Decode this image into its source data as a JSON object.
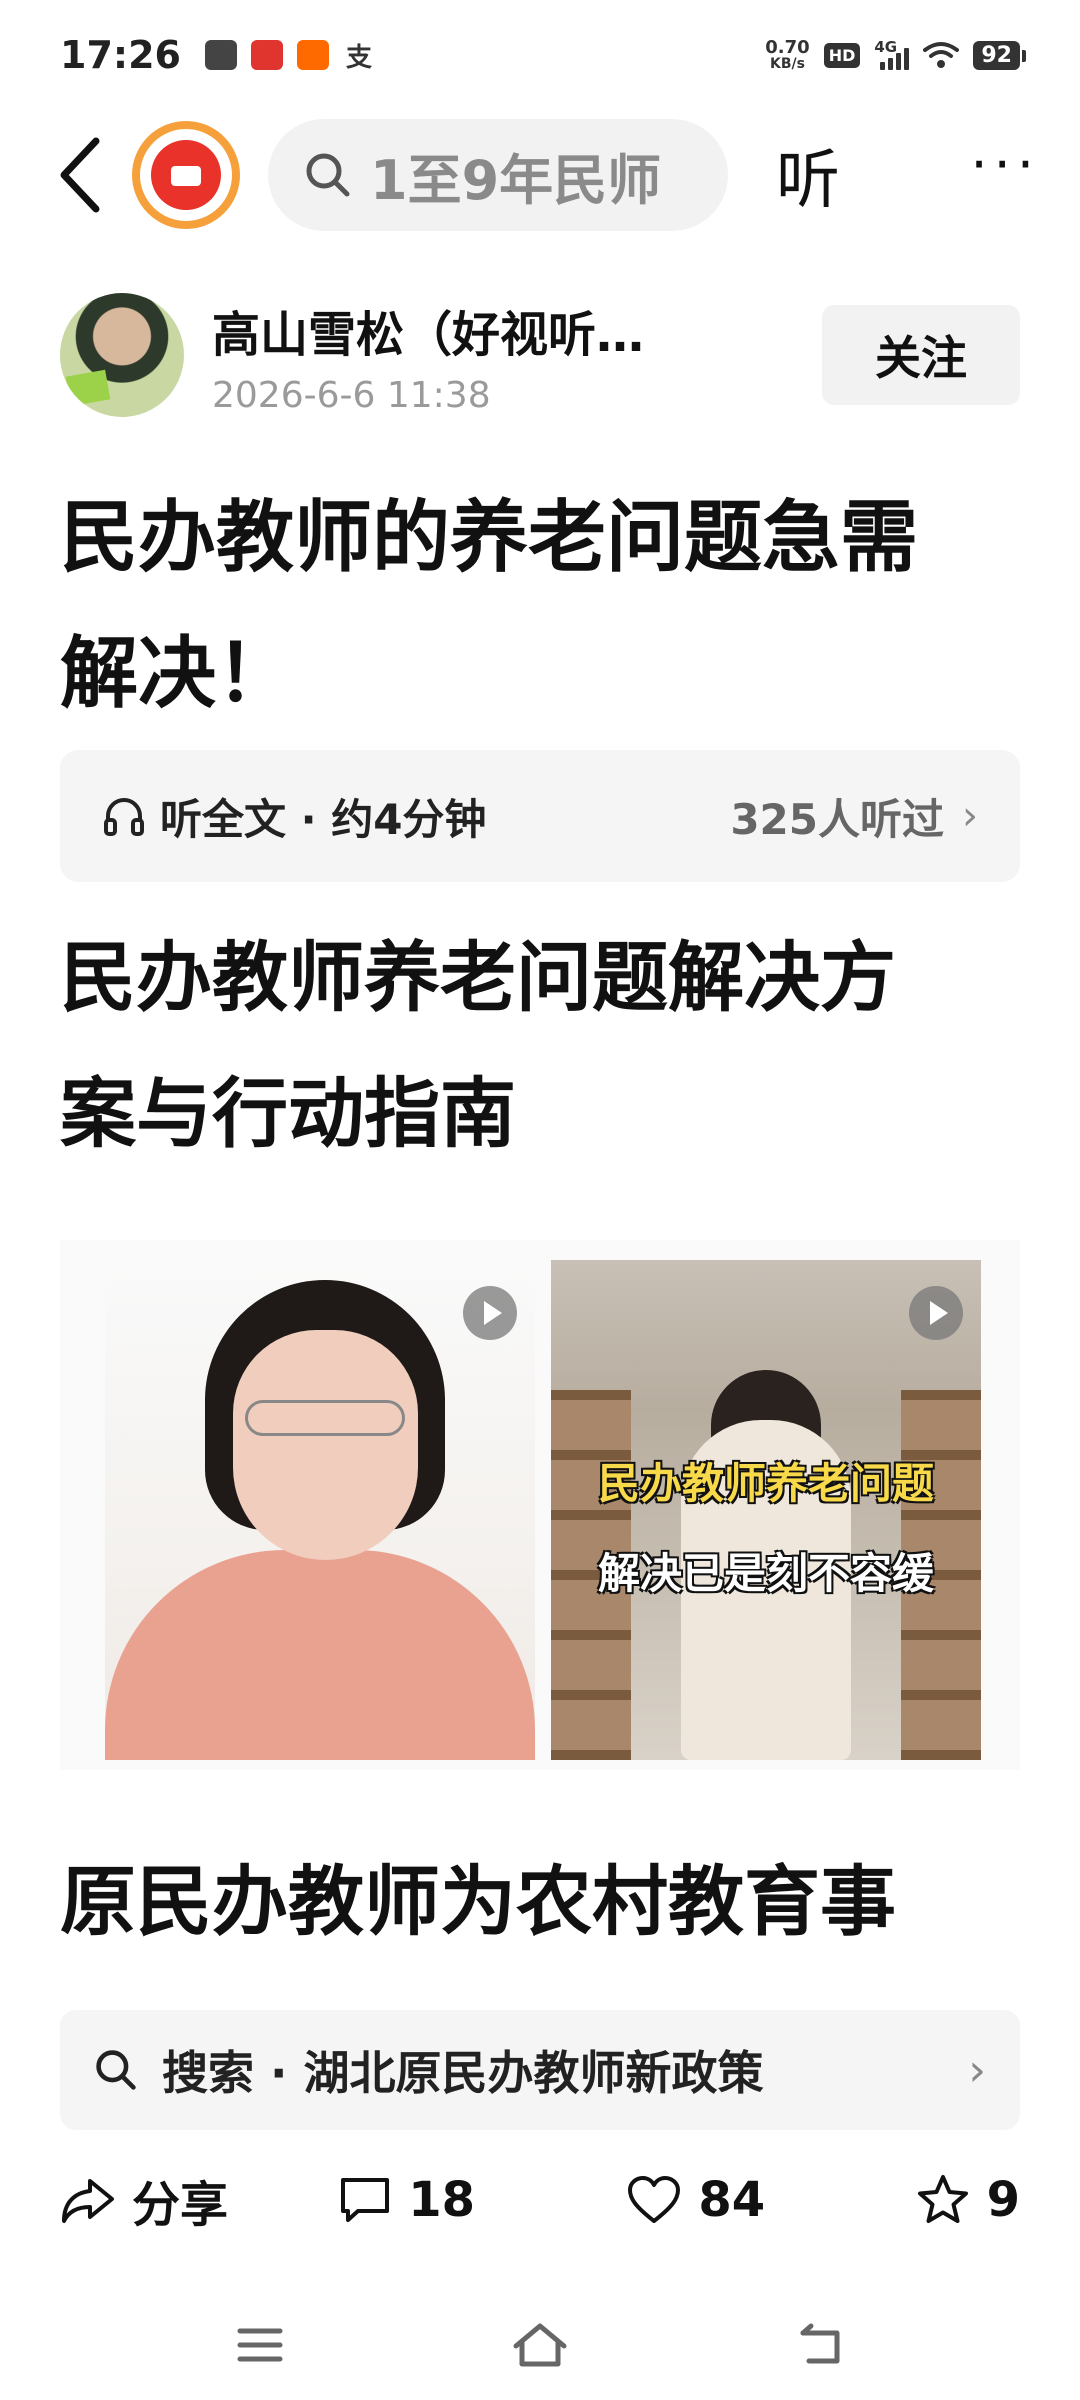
{
  "status_bar": {
    "time": "17:26",
    "app_icons": [
      "头条",
      "爱心",
      "淘",
      "支"
    ],
    "net_speed_value": "0.70",
    "net_speed_unit": "KB/s",
    "hd_label": "HD",
    "signal_label": "4G",
    "battery": "92"
  },
  "top_nav": {
    "search_text": "1至9年民师",
    "listen_label": "听",
    "more_label": "···"
  },
  "author": {
    "name": "高山雪松（好视听…",
    "time": "2026-6-6 11:38",
    "follow_label": "关注"
  },
  "article": {
    "title_line1": "民办教师的养老问题急需",
    "title_line2": "解决！",
    "listen_bar": {
      "label": "听全文 · 约4分钟",
      "count": "325人听过"
    },
    "subtitle_line1": "民办教师养老问题解决方",
    "subtitle_line2": "案与行动指南",
    "video_caption_line1": "民办教师养老问题",
    "video_caption_line2": "解决已是刻不容缓",
    "section_heading": "原民办教师为农村教育事"
  },
  "search_suggest": {
    "text": "搜索 · 湖北原民办教师新政策"
  },
  "actions": {
    "share_label": "分享",
    "comment_count": "18",
    "like_count": "84",
    "favorite_count": "9"
  },
  "colors": {
    "accent_red": "#e8322a",
    "ring_orange": "#f6a03c",
    "muted_gray": "#9a9a9a"
  }
}
